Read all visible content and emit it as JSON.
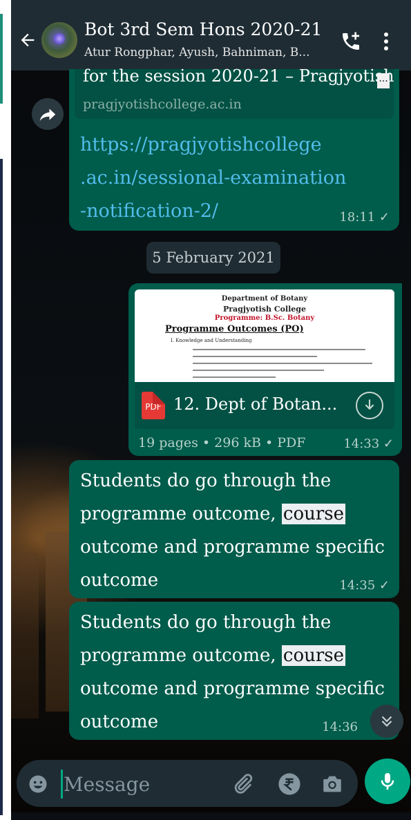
{
  "header": {
    "title": "Bot 3rd Sem Hons 2020-21",
    "subtitle": "Atur Rongphar, Ayush, Bahniman, B..."
  },
  "messages": {
    "link_msg": {
      "preview_title": "for the session 2020-21 – Pragjyotish",
      "preview_ellipsis": "...",
      "preview_domain": "pragjyotishcollege.ac.in",
      "link_line1": "https://pragjyotishcollege",
      "link_line2": ".ac.in/sessional-examination",
      "link_line3": "-notification-2/",
      "time": "18:11 ✓"
    },
    "date_chip": "5 February 2021",
    "doc_msg": {
      "thumb_line1": "Department of Botany",
      "thumb_line2": "Pragjyotish College",
      "thumb_line3": "Programme: B.Sc. Botany",
      "thumb_heading": "Programme Outcomes (PO)",
      "thumb_sub": "I.     Knowledge and Understanding",
      "pdf_badge": "PDF",
      "file_name": "12. Dept of Botan...",
      "meta": "19 pages • 296 kB • PDF",
      "time": "14:33 ✓"
    },
    "text_msg_1": {
      "before": "Students do go through the programme outcome, ",
      "highlight": "course",
      "after": " outcome and programme specific outcome",
      "time": "14:35 ✓"
    },
    "text_msg_2": {
      "before": "Students do go through the programme outcome, ",
      "highlight": "course",
      "after": " outcome and programme specific outcome",
      "time": "14:36"
    }
  },
  "composer": {
    "placeholder": "Message"
  },
  "icons": {
    "back": "arrow-left-icon",
    "call": "add-call-icon",
    "menu": "more-vert-icon",
    "forward": "forward-icon",
    "download": "download-icon",
    "scroll": "chevron-double-down-icon",
    "emoji": "emoji-icon",
    "attach": "paperclip-icon",
    "payment": "rupee-icon",
    "camera": "camera-icon",
    "mic": "mic-icon"
  },
  "colors": {
    "header_bg": "#1f2c34",
    "bubble_out": "#005c4b",
    "link": "#53bdeb",
    "accent": "#00a884"
  }
}
